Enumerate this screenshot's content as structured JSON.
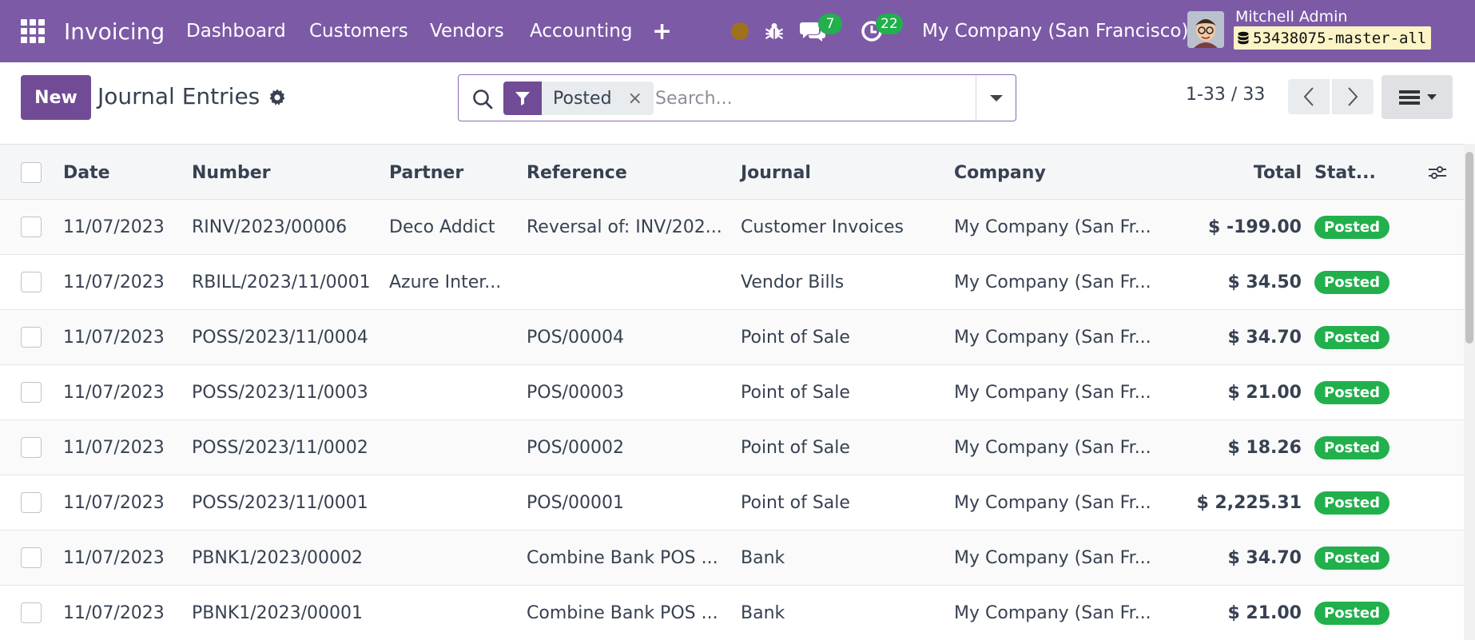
{
  "navbar": {
    "app_name": "Invoicing",
    "menu": [
      "Dashboard",
      "Customers",
      "Vendors",
      "Accounting"
    ],
    "messages_count": "7",
    "activities_count": "22",
    "company": "My Company (San Francisco)",
    "user_name": "Mitchell Admin",
    "db_name": "53438075-master-all",
    "accent": "#7c5aa6"
  },
  "control": {
    "new_label": "New",
    "title": "Journal Entries",
    "facet_label": "Posted",
    "search_placeholder": "Search...",
    "pager": "1-33 / 33"
  },
  "table": {
    "headers": {
      "date": "Date",
      "number": "Number",
      "partner": "Partner",
      "reference": "Reference",
      "journal": "Journal",
      "company": "Company",
      "total": "Total",
      "status": "Stat..."
    },
    "rows": [
      {
        "date": "11/07/2023",
        "number": "RINV/2023/00006",
        "partner": "Deco Addict",
        "reference": "Reversal of: INV/202...",
        "journal": "Customer Invoices",
        "company": "My Company (San Fr...",
        "total": "$ -199.00",
        "status": "Posted"
      },
      {
        "date": "11/07/2023",
        "number": "RBILL/2023/11/0001",
        "partner": "Azure Inter...",
        "reference": "",
        "journal": "Vendor Bills",
        "company": "My Company (San Fr...",
        "total": "$ 34.50",
        "status": "Posted"
      },
      {
        "date": "11/07/2023",
        "number": "POSS/2023/11/0004",
        "partner": "",
        "reference": "POS/00004",
        "journal": "Point of Sale",
        "company": "My Company (San Fr...",
        "total": "$ 34.70",
        "status": "Posted"
      },
      {
        "date": "11/07/2023",
        "number": "POSS/2023/11/0003",
        "partner": "",
        "reference": "POS/00003",
        "journal": "Point of Sale",
        "company": "My Company (San Fr...",
        "total": "$ 21.00",
        "status": "Posted"
      },
      {
        "date": "11/07/2023",
        "number": "POSS/2023/11/0002",
        "partner": "",
        "reference": "POS/00002",
        "journal": "Point of Sale",
        "company": "My Company (San Fr...",
        "total": "$ 18.26",
        "status": "Posted"
      },
      {
        "date": "11/07/2023",
        "number": "POSS/2023/11/0001",
        "partner": "",
        "reference": "POS/00001",
        "journal": "Point of Sale",
        "company": "My Company (San Fr...",
        "total": "$ 2,225.31",
        "status": "Posted"
      },
      {
        "date": "11/07/2023",
        "number": "PBNK1/2023/00002",
        "partner": "",
        "reference": "Combine Bank POS ...",
        "journal": "Bank",
        "company": "My Company (San Fr...",
        "total": "$ 34.70",
        "status": "Posted"
      },
      {
        "date": "11/07/2023",
        "number": "PBNK1/2023/00001",
        "partner": "",
        "reference": "Combine Bank POS ...",
        "journal": "Bank",
        "company": "My Company (San Fr...",
        "total": "$ 21.00",
        "status": "Posted"
      }
    ]
  },
  "colors": {
    "primary": "#714b96",
    "posted_badge": "#21b04c",
    "counter_badge": "#21b04c"
  }
}
